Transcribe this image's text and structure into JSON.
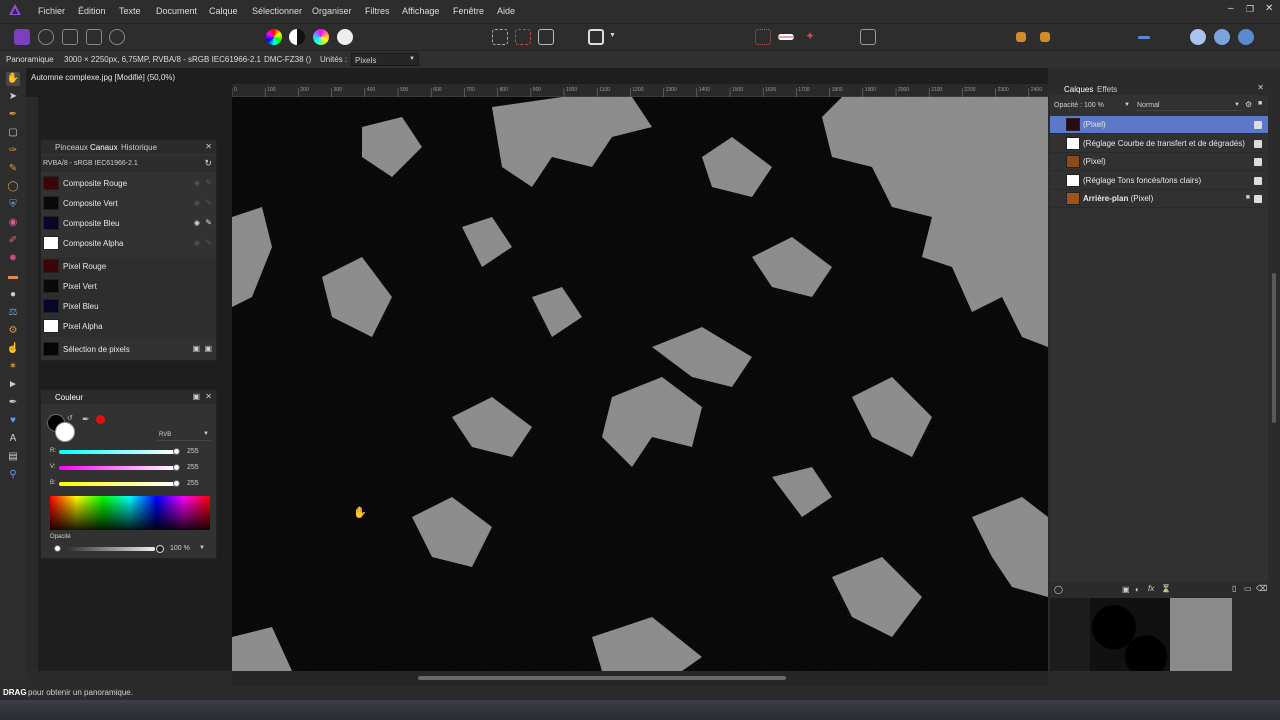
{
  "menubar": {
    "items": [
      "Fichier",
      "Édition",
      "Texte",
      "Document",
      "Calque",
      "Sélectionner",
      "Organiser",
      "Filtres",
      "Affichage",
      "Fenêtre",
      "Aide"
    ]
  },
  "context": {
    "tool_name": "Panoramique",
    "image_info": "3000 × 2250px, 6,75MP, RVBA/8 - sRGB IEC61966-2.1",
    "camera": "DMC-FZ38 ()",
    "units_label": "Unités :",
    "units_value": "Pixels"
  },
  "document": {
    "title": "Automne complexe.jpg [Modifié] (50,0%)"
  },
  "ruler": {
    "labels": [
      "-500",
      "-400",
      "-300",
      "-200",
      "-100",
      "0",
      "100",
      "200",
      "300",
      "400",
      "500",
      "600",
      "700",
      "800",
      "900",
      "1000",
      "1100",
      "1200",
      "1300",
      "1400",
      "1500",
      "1600",
      "1700",
      "1800",
      "1900",
      "2000",
      "2100",
      "2200",
      "2300",
      "2400"
    ]
  },
  "channels_panel": {
    "tabs": [
      "Pinceaux",
      "Canaux",
      "Historique"
    ],
    "active_tab": "Canaux",
    "profile": "RVBA/8 - sRGB IEC61966-2.1",
    "channels": [
      {
        "label": "Composite Rouge",
        "swatch": "#3a0608"
      },
      {
        "label": "Composite Vert",
        "swatch": "#0a0a0a"
      },
      {
        "label": "Composite Bleu",
        "swatch": "#07072a"
      },
      {
        "label": "Composite Alpha",
        "swatch": "#ffffff"
      },
      {
        "label": "Pixel Rouge",
        "swatch": "#3a0608"
      },
      {
        "label": "Pixel Vert",
        "swatch": "#0a0a0a"
      },
      {
        "label": "Pixel Bleu",
        "swatch": "#07072a"
      },
      {
        "label": "Pixel Alpha",
        "swatch": "#ffffff"
      },
      {
        "label": "Sélection de pixels",
        "swatch": "#050505"
      }
    ]
  },
  "color_panel": {
    "title": "Couleur",
    "mode": "RVB",
    "r_label": "R:",
    "g_label": "V:",
    "b_label": "B:",
    "r": "255",
    "g": "255",
    "b": "255",
    "opacity_label": "Opacité",
    "opacity": "100 %"
  },
  "layers_panel": {
    "tabs": [
      "Calques",
      "Effets"
    ],
    "opacity_label": "Opacité :",
    "opacity": "100 %",
    "blend_mode": "Normal",
    "layers": [
      {
        "label": "(Pixel)",
        "selected": true
      },
      {
        "label": "(Réglage Courbe de transfert et de dégradés)",
        "selected": false
      },
      {
        "label": "(Pixel)",
        "selected": false
      },
      {
        "label": "(Réglage Tons foncés/tons clairs)",
        "selected": false
      },
      {
        "label_bold": "Arrière-plan",
        "label": "(Pixel)",
        "selected": false
      }
    ]
  },
  "status": {
    "key": "DRAG",
    "text": "pour obtenir un panoramique."
  },
  "colors": {
    "accent": "#7b3fbf",
    "selection": "#5b79c8"
  }
}
